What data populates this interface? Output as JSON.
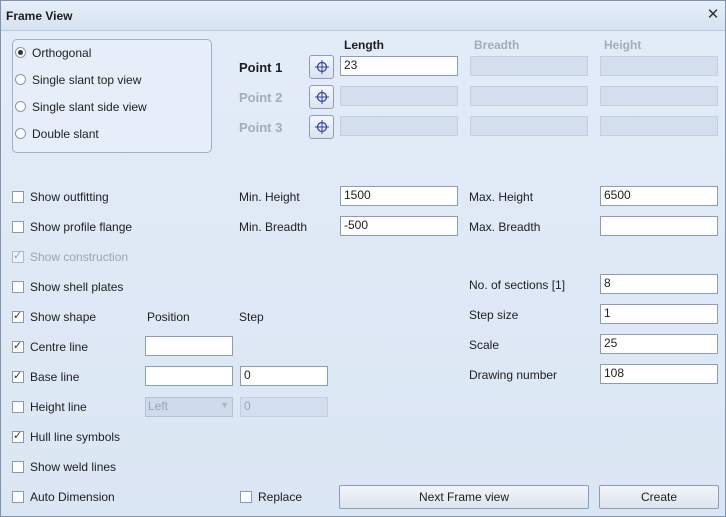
{
  "window": {
    "title": "Frame View",
    "close_glyph": "✕"
  },
  "view_type": {
    "options": [
      {
        "label": "Orthogonal",
        "selected": true
      },
      {
        "label": "Single slant top view",
        "selected": false
      },
      {
        "label": "Single slant side view",
        "selected": false
      },
      {
        "label": "Double slant",
        "selected": false
      }
    ]
  },
  "points": {
    "headers": {
      "length": "Length",
      "breadth": "Breadth",
      "height": "Height"
    },
    "rows": [
      {
        "label": "Point 1",
        "length": "23",
        "breadth": "",
        "height": "",
        "enabled": true
      },
      {
        "label": "Point 2",
        "length": "",
        "breadth": "",
        "height": "",
        "enabled": false
      },
      {
        "label": "Point 3",
        "length": "",
        "breadth": "",
        "height": "",
        "enabled": false
      }
    ],
    "pick_icon": "crosshair-icon"
  },
  "options": {
    "show_outfitting": {
      "label": "Show outfitting",
      "checked": false
    },
    "show_profile_flange": {
      "label": "Show profile flange",
      "checked": false
    },
    "show_construction": {
      "label": "Show construction",
      "checked": true,
      "disabled": true
    },
    "show_shell_plates": {
      "label": "Show shell plates",
      "checked": false
    },
    "show_shape": {
      "label": "Show shape",
      "checked": true
    },
    "centre_line": {
      "label": "Centre line",
      "checked": true
    },
    "base_line": {
      "label": "Base line",
      "checked": true
    },
    "height_line": {
      "label": "Height line",
      "checked": false
    },
    "hull_line_symbols": {
      "label": "Hull line symbols",
      "checked": true
    },
    "show_weld_lines": {
      "label": "Show weld lines",
      "checked": false
    },
    "auto_dimension": {
      "label": "Auto Dimension",
      "checked": false
    },
    "replace": {
      "label": "Replace",
      "checked": false
    }
  },
  "columns": {
    "position": "Position",
    "step": "Step"
  },
  "line_fields": {
    "centre_position": "",
    "base_position": "",
    "base_step": "0",
    "height_position": "Left",
    "height_step": "0"
  },
  "limits": {
    "min_height_label": "Min. Height",
    "min_height": "1500",
    "max_height_label": "Max. Height",
    "max_height": "6500",
    "min_breadth_label": "Min. Breadth",
    "min_breadth": "-500",
    "max_breadth_label": "Max. Breadth",
    "max_breadth": ""
  },
  "sections": {
    "count_label": "No. of sections [1]",
    "count": "8",
    "step_label": "Step size",
    "step": "1",
    "scale_label": "Scale",
    "scale": "25",
    "drawing_label": "Drawing number",
    "drawing": "108"
  },
  "buttons": {
    "next_frame": "Next Frame view",
    "create": "Create"
  }
}
